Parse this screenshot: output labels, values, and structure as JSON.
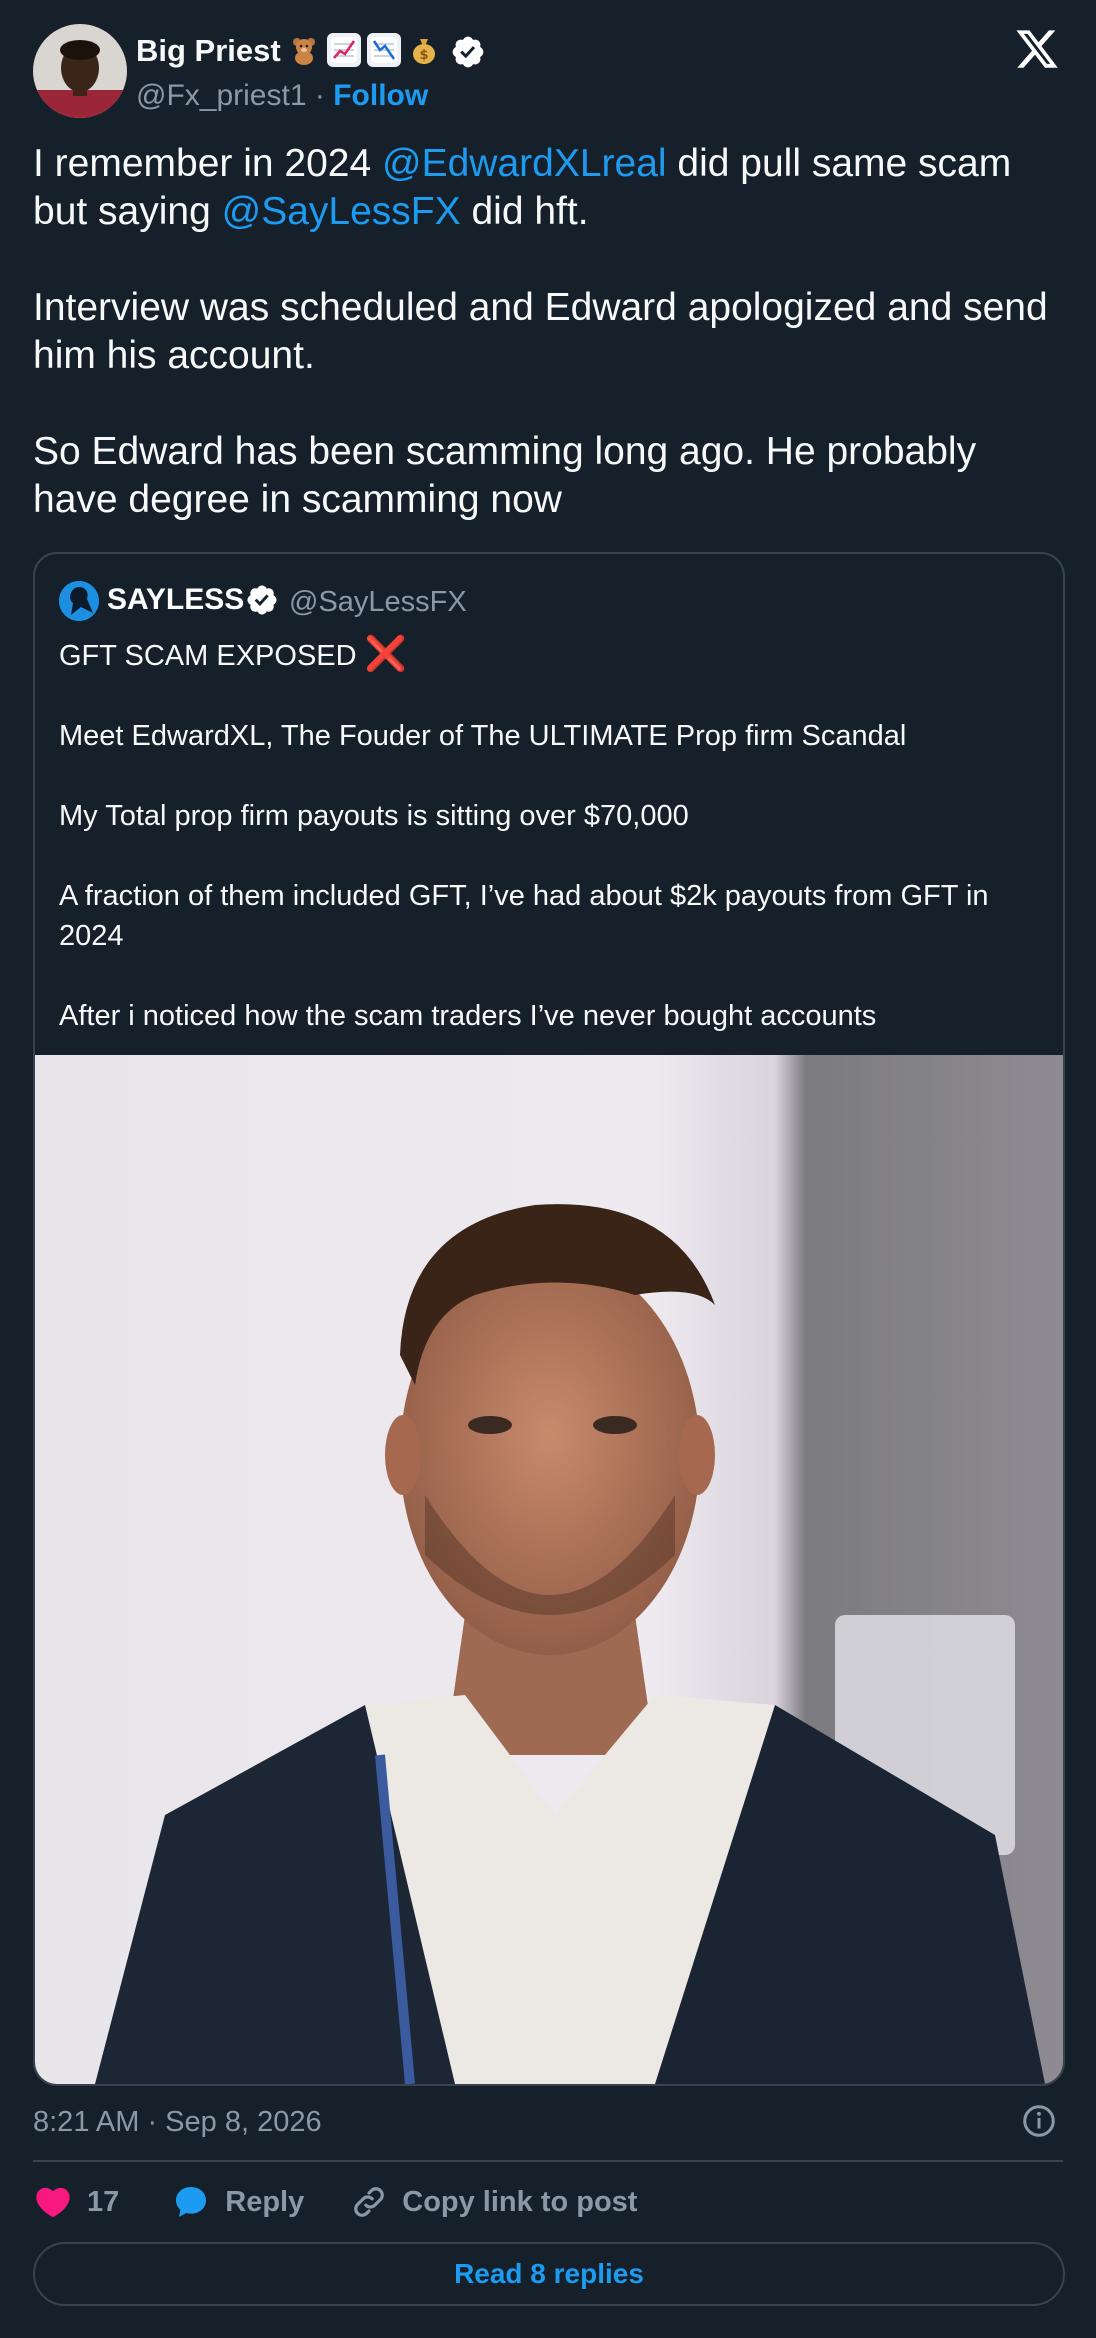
{
  "author": {
    "display_name": "Big Priest",
    "badges": [
      "teddy-bear-emoji",
      "chart-increasing-emoji",
      "chart-decreasing-emoji",
      "money-bag-emoji"
    ],
    "handle": "@Fx_priest1",
    "separator": "·",
    "follow_label": "Follow"
  },
  "tweet": {
    "lines": [
      {
        "parts": [
          {
            "text": "I remember in 2024 ",
            "type": "text"
          },
          {
            "text": "@EdwardXLreal",
            "type": "mention"
          },
          {
            "text": "  did pull same scam but saying ",
            "type": "text"
          },
          {
            "text": "@SayLessFX",
            "type": "mention"
          },
          {
            "text": "  did hft.",
            "type": "text"
          }
        ]
      },
      {
        "text": "Interview was scheduled and Edward apologized and send him his account."
      },
      {
        "text": "So Edward has been scamming long ago.  He probably have degree in scamming now"
      }
    ]
  },
  "quote": {
    "name": "SAYLESS",
    "handle": "@SayLessFX",
    "headline": "GFT SCAM EXPOSED",
    "headline_mark": "❌",
    "paragraphs": [
      "Meet EdwardXL, The Fouder of The ULTIMATE Prop firm Scandal",
      "My Total prop firm payouts is sitting over $70,000",
      "A fraction of them included GFT, I’ve had about $2k payouts from GFT in 2024",
      "After i noticed how the scam traders I’ve never bought accounts"
    ]
  },
  "meta": {
    "timestamp": "8:21 AM · Sep 8, 2026"
  },
  "actions": {
    "like_count": "17",
    "reply_label": "Reply",
    "copy_label": "Copy link to post"
  },
  "footer": {
    "read_replies_label": "Read 8 replies"
  },
  "colors": {
    "background": "#15202b",
    "accent": "#1d9bf0",
    "like": "#f91880",
    "muted": "#8b98a5",
    "border": "#38444d"
  }
}
